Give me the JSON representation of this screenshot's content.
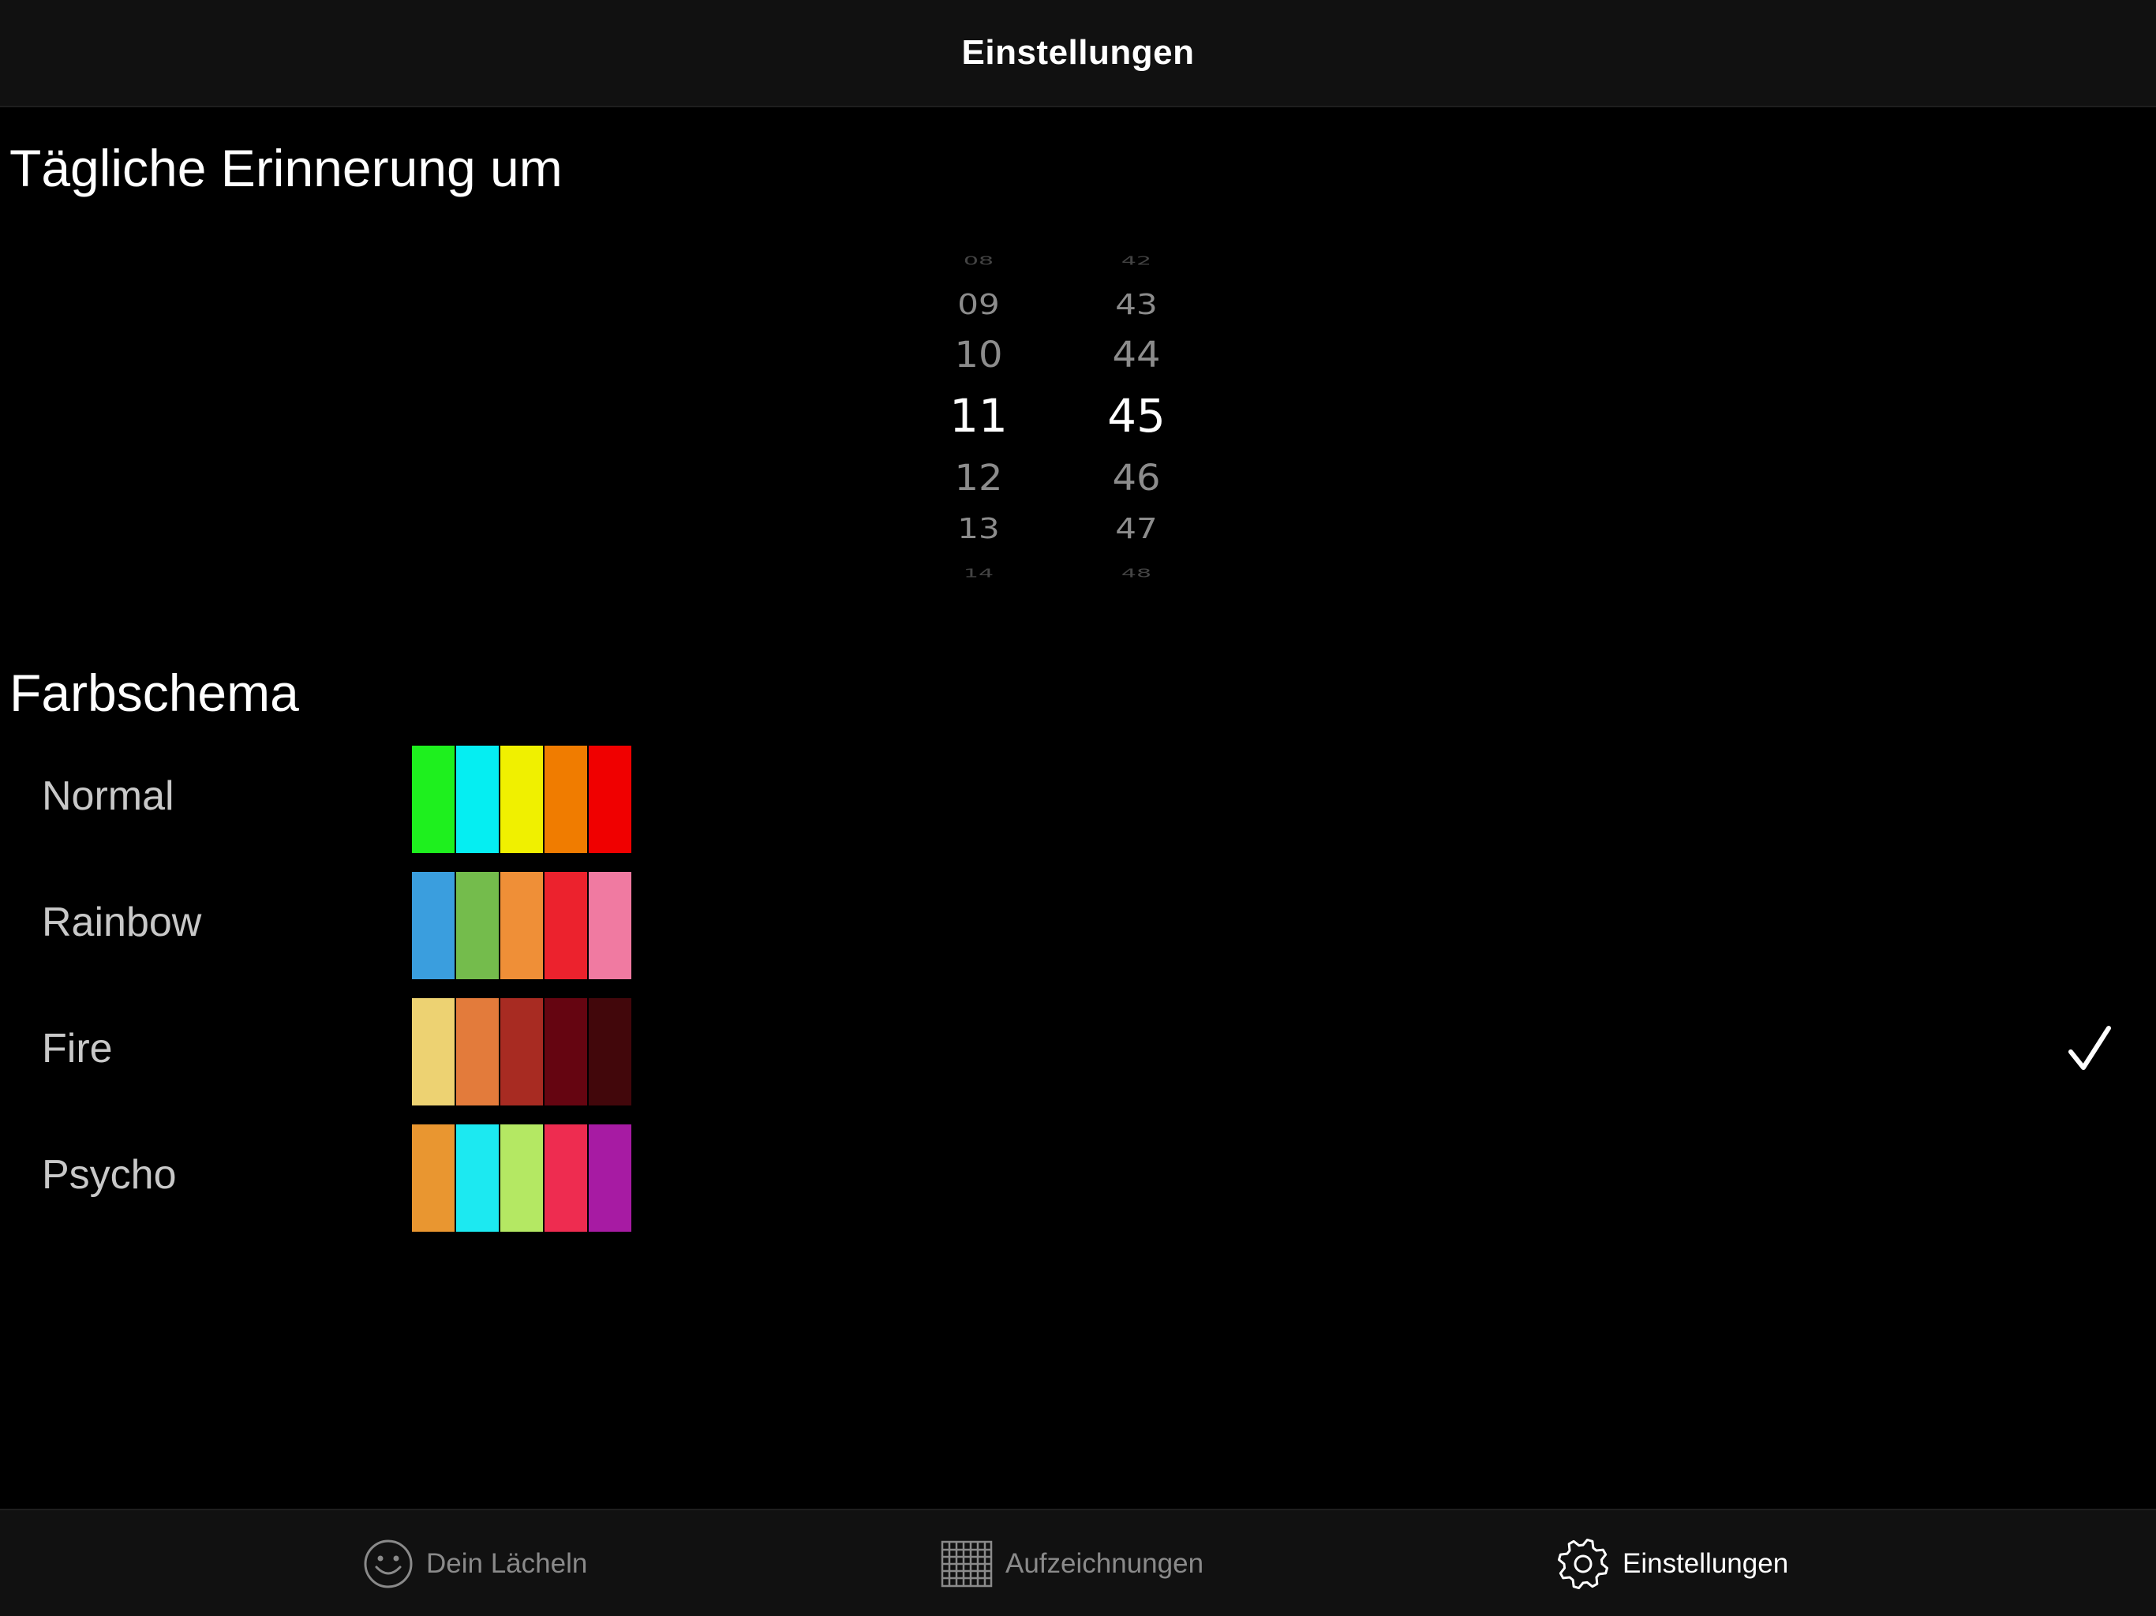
{
  "navbar": {
    "title": "Einstellungen"
  },
  "reminder": {
    "title": "Tägliche Erinnerung um",
    "hours": [
      "08",
      "09",
      "10",
      "11",
      "12",
      "13",
      "14"
    ],
    "minutes": [
      "42",
      "43",
      "44",
      "45",
      "46",
      "47",
      "48"
    ],
    "selected_hour": "11",
    "selected_minute": "45"
  },
  "color_scheme": {
    "title": "Farbschema",
    "selected": "Fire",
    "schemes": [
      {
        "name": "Normal",
        "colors": [
          "#1ef01e",
          "#05eef2",
          "#f0f000",
          "#f07c00",
          "#f00000"
        ]
      },
      {
        "name": "Rainbow",
        "colors": [
          "#3a9ede",
          "#74bc4c",
          "#ef8f37",
          "#ec222d",
          "#f07aa1"
        ]
      },
      {
        "name": "Fire",
        "colors": [
          "#edd272",
          "#e37b3b",
          "#a82b22",
          "#650511",
          "#42070b"
        ]
      },
      {
        "name": "Psycho",
        "colors": [
          "#e99630",
          "#1ce9f1",
          "#b4e863",
          "#ee2c50",
          "#a71ba3"
        ]
      }
    ]
  },
  "tabbar": {
    "tabs": [
      {
        "label": "Dein Lächeln",
        "icon": "smiley-icon",
        "active": false
      },
      {
        "label": "Aufzeichnungen",
        "icon": "grid-icon",
        "active": false
      },
      {
        "label": "Einstellungen",
        "icon": "gear-icon",
        "active": true
      }
    ]
  }
}
